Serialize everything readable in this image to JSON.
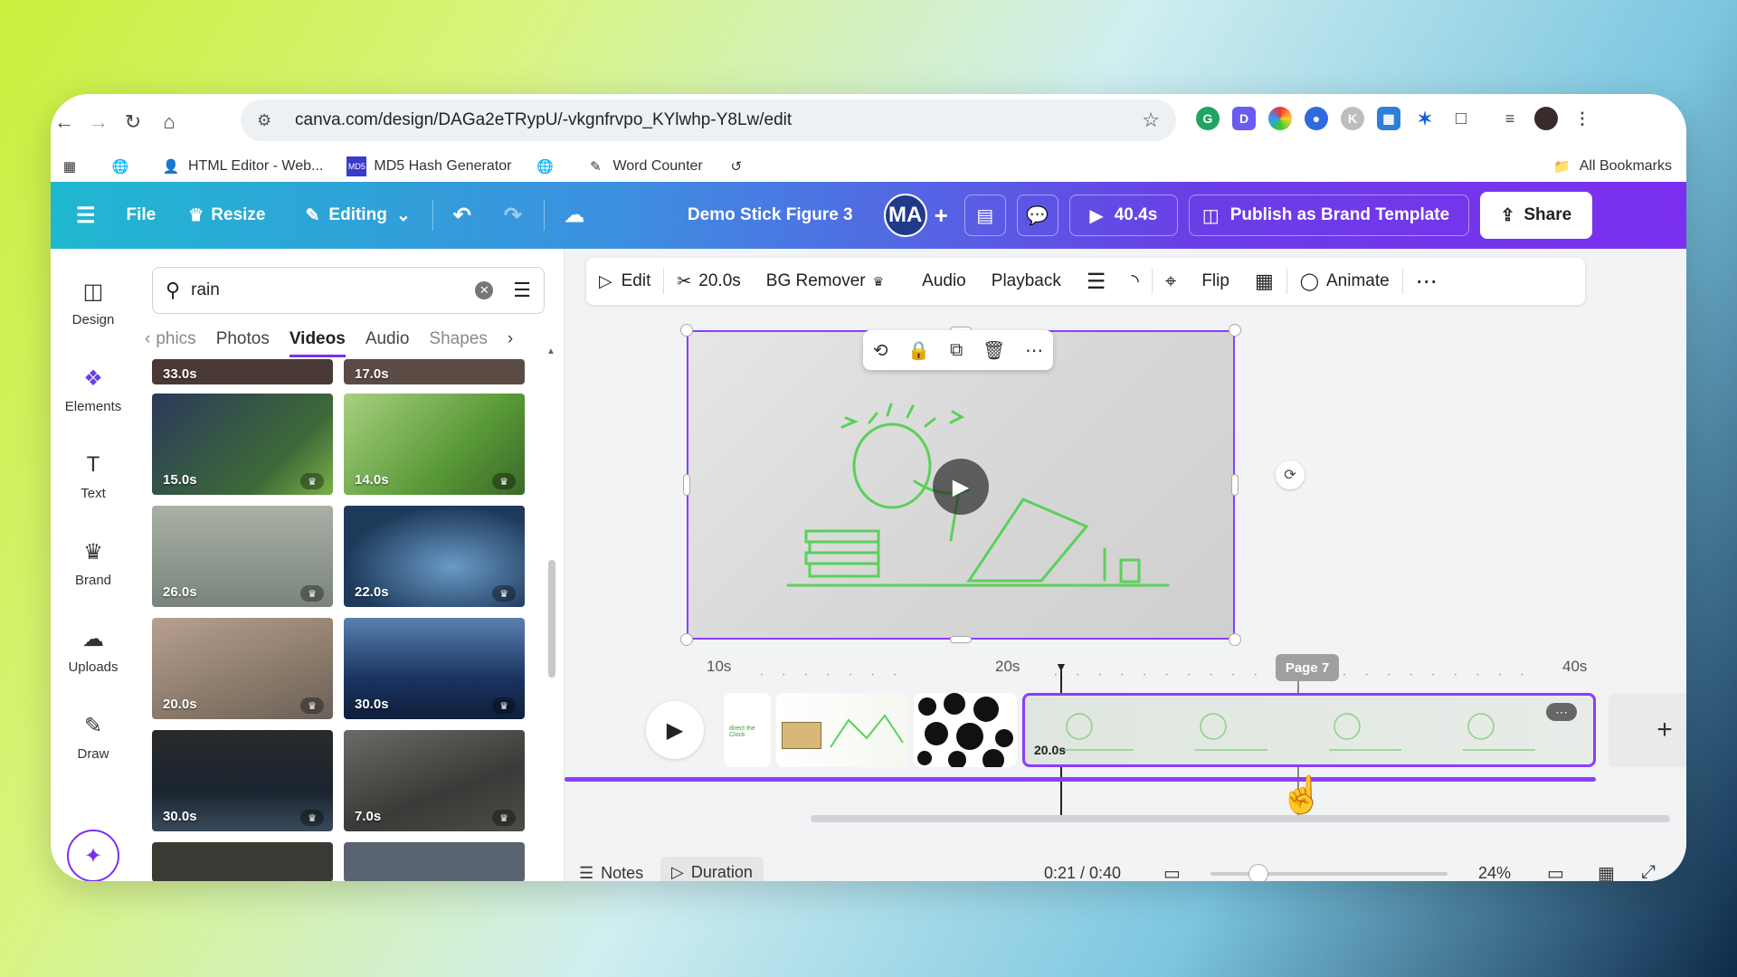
{
  "browser": {
    "url": "canva.com/design/DAGa2eTRypU/-vkgnfrvpo_KYlwhp-Y8Lw/edit",
    "bookmarks": [
      "HTML Editor - Web...",
      "MD5 Hash Generator",
      "Word Counter"
    ],
    "all_bookmarks": "All Bookmarks"
  },
  "header": {
    "file": "File",
    "resize": "Resize",
    "editing": "Editing",
    "title": "Demo Stick Figure 3",
    "avatar": "MA",
    "play_time": "40.4s",
    "publish": "Publish as Brand Template",
    "share": "Share"
  },
  "rail": [
    "Design",
    "Elements",
    "Text",
    "Brand",
    "Uploads",
    "Draw"
  ],
  "panel": {
    "search_value": "rain",
    "tabs": [
      "phics",
      "Photos",
      "Videos",
      "Audio",
      "Shapes"
    ],
    "active_tab": "Videos",
    "top_durations": [
      "33.0s",
      "17.0s"
    ],
    "thumbs": [
      {
        "dur": "15.0s",
        "color": "#4a5a6a"
      },
      {
        "dur": "14.0s",
        "color": "#6aa048"
      },
      {
        "dur": "26.0s",
        "color": "#8a948c"
      },
      {
        "dur": "22.0s",
        "color": "#2a4a6a"
      },
      {
        "dur": "20.0s",
        "color": "#9a8878"
      },
      {
        "dur": "30.0s",
        "color": "#2a4a78"
      },
      {
        "dur": "30.0s",
        "color": "#1c2430"
      },
      {
        "dur": "7.0s",
        "color": "#4a4a48"
      }
    ]
  },
  "context_bar": {
    "edit": "Edit",
    "trim": "20.0s",
    "bg_remover": "BG Remover",
    "audio": "Audio",
    "playback": "Playback",
    "flip": "Flip",
    "animate": "Animate"
  },
  "timeline": {
    "ticks": [
      "10s",
      "20s",
      "40s"
    ],
    "page_label": "Page 7",
    "clip_duration": "20.0s",
    "clip_text": "direct the Clock"
  },
  "footer": {
    "notes": "Notes",
    "duration": "Duration",
    "time": "0:21 / 0:40",
    "zoom": "24%"
  },
  "colors": {
    "accent": "#8b3dff",
    "header_start": "#1fb8d0",
    "header_end": "#7b2ff0"
  }
}
